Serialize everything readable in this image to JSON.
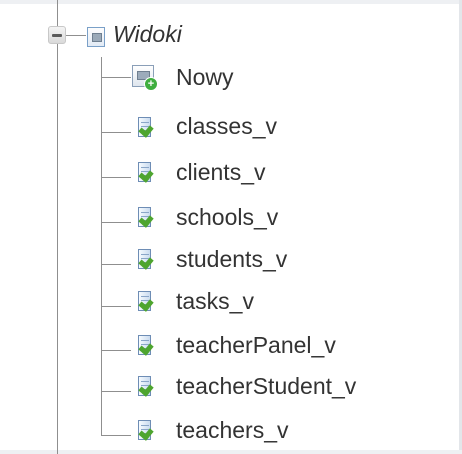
{
  "tree": {
    "root": {
      "label": "Widoki",
      "icon": "views-folder-icon",
      "expanded": true
    },
    "items": [
      {
        "label": "Nowy",
        "icon": "new-view-icon"
      },
      {
        "label": "classes_v",
        "icon": "view-icon"
      },
      {
        "label": "clients_v",
        "icon": "view-icon"
      },
      {
        "label": "schools_v",
        "icon": "view-icon"
      },
      {
        "label": "students_v",
        "icon": "view-icon"
      },
      {
        "label": "tasks_v",
        "icon": "view-icon"
      },
      {
        "label": "teacherPanel_v",
        "icon": "view-icon"
      },
      {
        "label": "teacherStudent_v",
        "icon": "view-icon"
      },
      {
        "label": "teachers_v",
        "icon": "view-icon"
      }
    ]
  },
  "colors": {
    "tree_line": "#8f8f8f",
    "text": "#333333",
    "check_green": "#4ea52f"
  }
}
